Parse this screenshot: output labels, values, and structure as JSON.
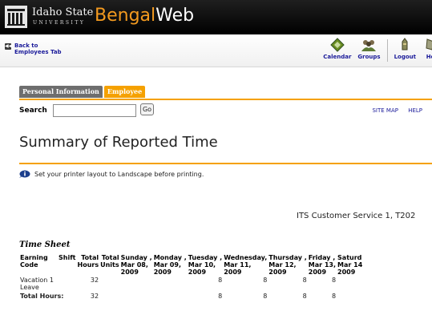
{
  "banner": {
    "university_line1": "Idaho State",
    "university_line2": "UNIVERSITY",
    "brand_part1": "Bengal",
    "brand_part2": "Web",
    "brand_color": "#f39a1f"
  },
  "nav": {
    "back_line1": "Back to",
    "back_line2": "Employees Tab",
    "links": [
      {
        "label": "Calendar",
        "icon": "calendar-icon"
      },
      {
        "label": "Groups",
        "icon": "groups-icon"
      },
      {
        "label": "Logout",
        "icon": "logout-icon"
      },
      {
        "label": "He",
        "icon": "help-icon"
      }
    ]
  },
  "tabs": {
    "personal": "Personal Information",
    "employee": "Employee",
    "active_color": "#f5a100"
  },
  "search": {
    "label": "Search",
    "value": "",
    "go_label": "Go"
  },
  "toplinks": {
    "site_map": "SITE MAP",
    "help": "HELP"
  },
  "page": {
    "title": "Summary of Reported Time",
    "note": "Set your printer layout to Landscape before printing.",
    "department": "ITS Customer Service 1, T202"
  },
  "timesheet": {
    "caption": "Time Sheet",
    "headers": {
      "earning_line1": "Earning",
      "earning_line2": "Code",
      "shift": "Shift",
      "hours_line1": "Total",
      "hours_line2": "Hours",
      "units_line1": "Total",
      "units_line2": "Units"
    },
    "days": [
      {
        "line1": "Sunday ,",
        "line2": "Mar 08,",
        "line3": "2009"
      },
      {
        "line1": "Monday ,",
        "line2": "Mar 09,",
        "line3": "2009"
      },
      {
        "line1": "Tuesday ,",
        "line2": "Mar 10,",
        "line3": "2009"
      },
      {
        "line1": "Wednesday,",
        "line2": "Mar 11,",
        "line3": "2009"
      },
      {
        "line1": "Thursday ,",
        "line2": "Mar 12,",
        "line3": "2009"
      },
      {
        "line1": "Friday ,",
        "line2": "Mar 13,",
        "line3": "2009"
      },
      {
        "line1": "Saturd",
        "line2": "Mar 14",
        "line3": "2009"
      }
    ],
    "row": {
      "code": "Vacation 1 Leave",
      "hours": "32",
      "units": "",
      "values": [
        "",
        "",
        "8",
        "8",
        "8",
        "8",
        ""
      ]
    },
    "total": {
      "label": "Total Hours:",
      "hours": "32",
      "values": [
        "",
        "",
        "8",
        "8",
        "8",
        "8",
        ""
      ]
    }
  }
}
